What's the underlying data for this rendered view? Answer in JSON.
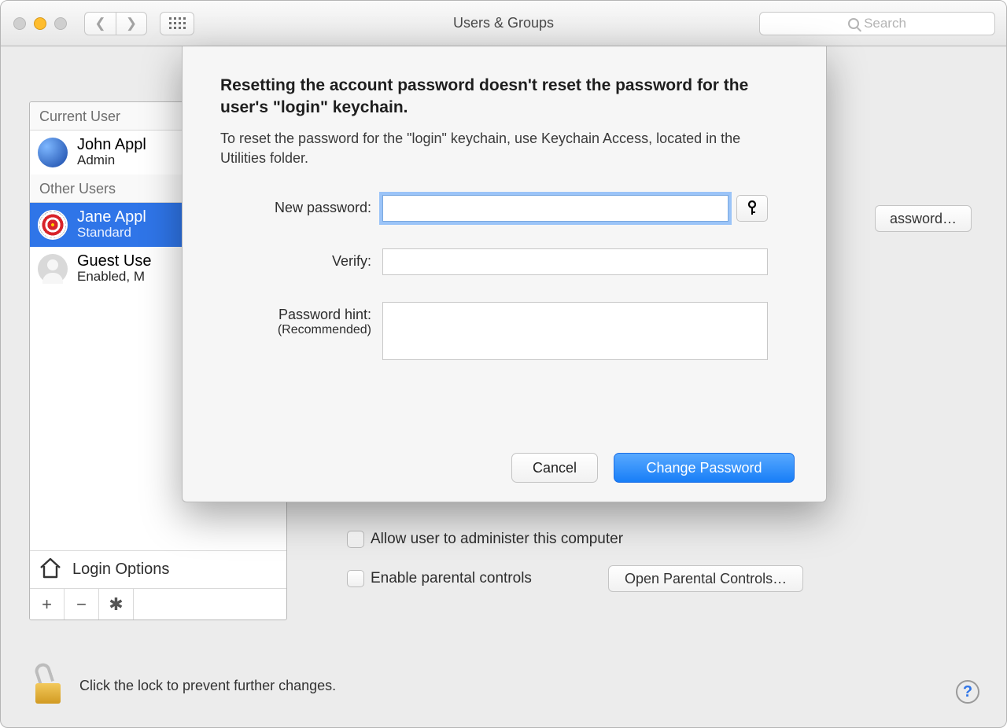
{
  "title": "Users & Groups",
  "search_placeholder": "Search",
  "sidebar": {
    "section_current": "Current User",
    "section_other": "Other Users",
    "users": {
      "john": {
        "name": "John Appl",
        "role": "Admin"
      },
      "jane": {
        "name": "Jane Appl",
        "role": "Standard"
      },
      "guest": {
        "name": "Guest Use",
        "role": "Enabled, M"
      }
    },
    "login_options": "Login Options"
  },
  "main": {
    "reset_button": "assword…",
    "allow_admin": "Allow user to administer this computer",
    "parental": "Enable parental controls",
    "open_parental": "Open Parental Controls…"
  },
  "footer": {
    "lock_text": "Click the lock to prevent further changes.",
    "help": "?"
  },
  "sheet": {
    "headline": "Resetting the account password doesn't reset the password for the user's \"login\" keychain.",
    "sub": "To reset the password for the \"login\" keychain, use Keychain Access, located in the Utilities folder.",
    "new_password_label": "New password:",
    "verify_label": "Verify:",
    "hint_label": "Password hint:",
    "hint_rec": "(Recommended)",
    "cancel": "Cancel",
    "change": "Change Password"
  }
}
